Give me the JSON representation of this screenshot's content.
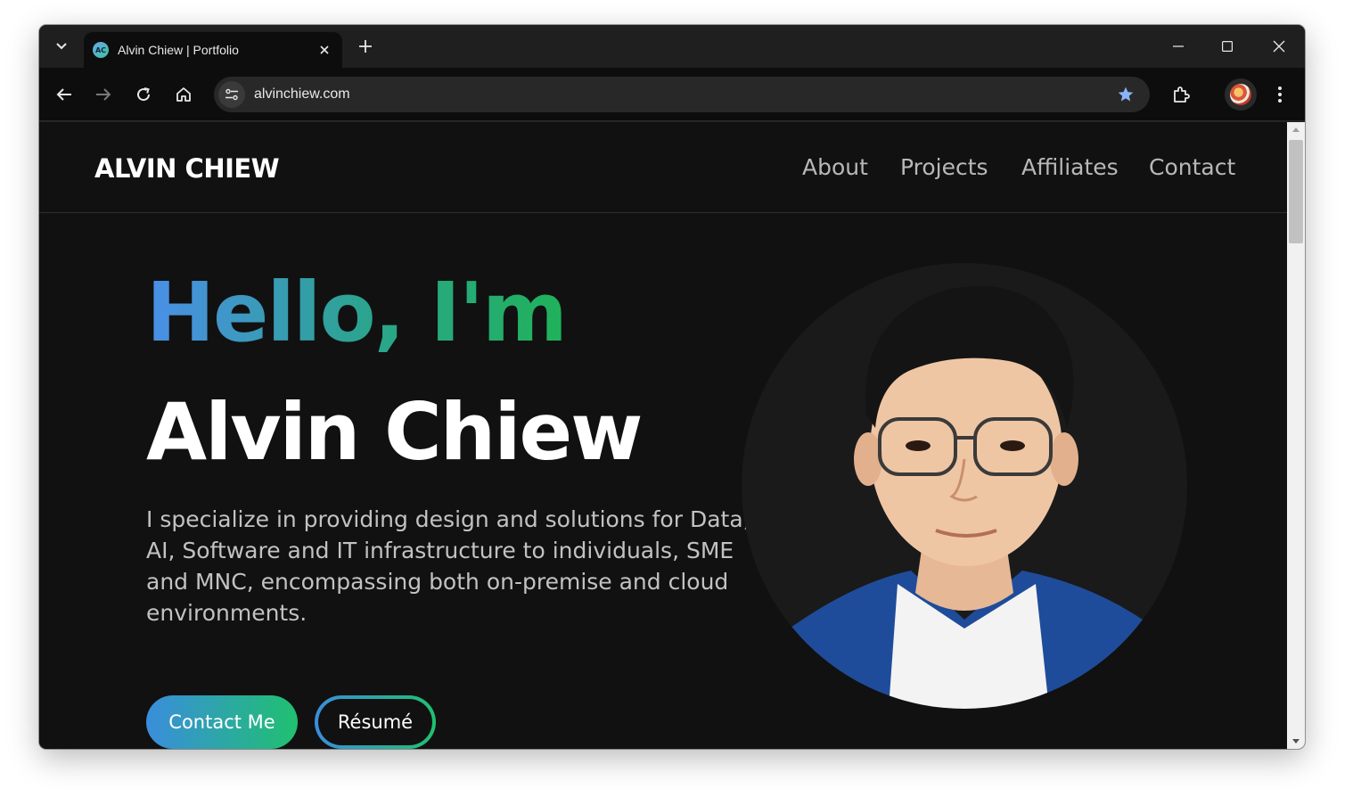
{
  "browser": {
    "tab_title": "Alvin Chiew | Portfolio",
    "favicon_text": "AC",
    "url": "alvinchiew.com"
  },
  "site": {
    "brand": "ALVIN CHIEW",
    "nav": [
      "About",
      "Projects",
      "Affiliates",
      "Contact"
    ],
    "hero": {
      "greeting": "Hello, I'm",
      "name": "Alvin Chiew",
      "description": "I specialize in providing design and solutions for Data, AI, Software and IT infrastructure to individuals, SME and MNC, encompassing both on-premise and cloud environments.",
      "primary_button": "Contact Me",
      "secondary_button": "Résumé"
    }
  },
  "colors": {
    "page_background": "#111111",
    "gradient_start": "#4a8fe8",
    "gradient_end": "#20b25a",
    "bookmark_star": "#8ab4f8"
  },
  "icons": [
    "tab-search-icon",
    "close-icon",
    "plus-icon",
    "minimize-icon",
    "maximize-icon",
    "window-close-icon",
    "back-arrow-icon",
    "forward-arrow-icon",
    "reload-icon",
    "home-icon",
    "site-info-icon",
    "star-icon",
    "extensions-icon",
    "profile-avatar",
    "more-menu-icon"
  ]
}
